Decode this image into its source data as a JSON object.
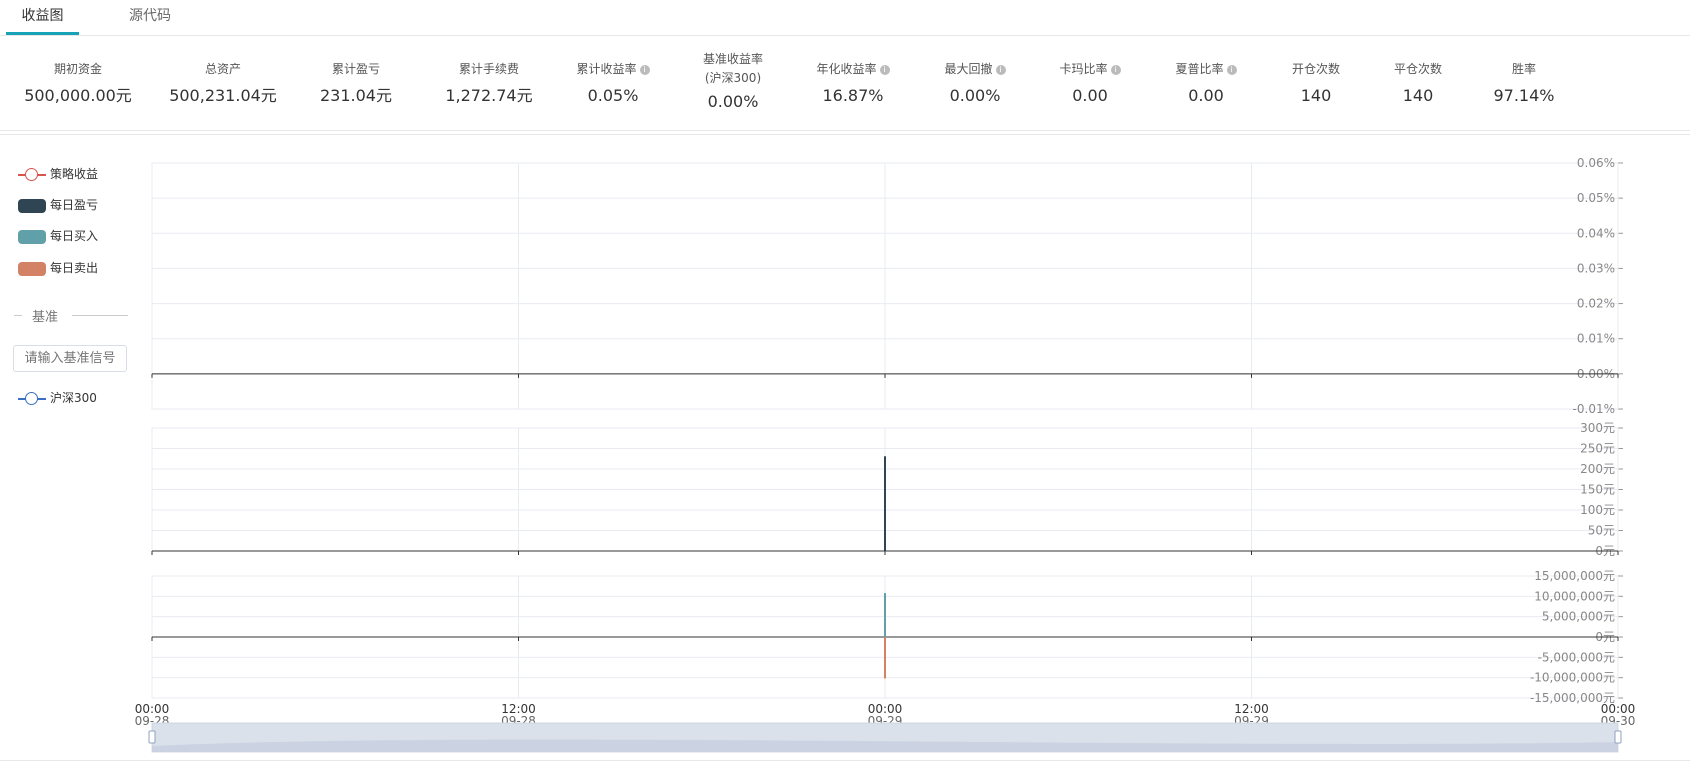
{
  "tabs": [
    {
      "label": "收益图"
    },
    {
      "label": "源代码"
    }
  ],
  "stats": [
    {
      "label": "期初资金",
      "value": "500,000.00元"
    },
    {
      "label": "总资产",
      "value": "500,231.04元"
    },
    {
      "label": "累计盈亏",
      "value": "231.04元"
    },
    {
      "label": "累计手续费",
      "value": "1,272.74元"
    },
    {
      "label": "累计收益率",
      "value": "0.05%"
    },
    {
      "label": "基准收益率",
      "label2": "(沪深300)",
      "value": "0.00%"
    },
    {
      "label": "年化收益率",
      "value": "16.87%"
    },
    {
      "label": "最大回撤",
      "value": "0.00%"
    },
    {
      "label": "卡玛比率",
      "value": "0.00"
    },
    {
      "label": "夏普比率",
      "value": "0.00"
    },
    {
      "label": "开仓次数",
      "value": "140"
    },
    {
      "label": "平仓次数",
      "value": "140"
    },
    {
      "label": "胜率",
      "value": "97.14%"
    }
  ],
  "info_icon": "i",
  "legend": [
    {
      "label": "策略收益",
      "type": "line",
      "color": "#d9534f"
    },
    {
      "label": "每日盈亏",
      "type": "rect",
      "color": "#2f4554"
    },
    {
      "label": "每日买入",
      "type": "rect",
      "color": "#61a0a8"
    },
    {
      "label": "每日卖出",
      "type": "rect",
      "color": "#d48265"
    }
  ],
  "benchmark": {
    "title": "基准",
    "placeholder": "请输入基准信号",
    "series": {
      "label": "沪深300",
      "color": "#3a6fc4"
    }
  },
  "chart_data": [
    {
      "type": "line",
      "y_tick_labels": [
        "0.06%",
        "0.05%",
        "0.04%",
        "0.03%",
        "0.02%",
        "0.01%",
        "0.00%",
        "-0.01%"
      ],
      "ylim": [
        -0.01,
        0.06
      ],
      "series": [
        {
          "name": "策略收益",
          "x": [],
          "values": []
        },
        {
          "name": "沪深300",
          "x": [],
          "values": []
        }
      ]
    },
    {
      "type": "bar",
      "y_tick_labels": [
        "300元",
        "250元",
        "200元",
        "150元",
        "100元",
        "50元",
        "0元"
      ],
      "ylim": [
        0,
        300
      ],
      "series": [
        {
          "name": "每日盈亏",
          "x": [
            "2023-09-29 00:00"
          ],
          "values": [
            231.04
          ]
        }
      ]
    },
    {
      "type": "bar",
      "y_tick_labels": [
        "15,000,000元",
        "10,000,000元",
        "5,000,000元",
        "0元",
        "-5,000,000元",
        "-10,000,000元",
        "-15,000,000元"
      ],
      "ylim": [
        -15000000,
        15000000
      ],
      "series": [
        {
          "name": "每日买入",
          "x": [
            "2023-09-29 00:00"
          ],
          "values": [
            10800000
          ]
        },
        {
          "name": "每日卖出",
          "x": [
            "2023-09-29 00:00"
          ],
          "values": [
            -10200000
          ]
        }
      ]
    }
  ],
  "x_axis": {
    "ticks": [
      {
        "time": "00:00",
        "date": "09-28"
      },
      {
        "time": "12:00",
        "date": "09-28"
      },
      {
        "time": "00:00",
        "date": "09-29"
      },
      {
        "time": "12:00",
        "date": "09-29"
      },
      {
        "time": "00:00",
        "date": "09-30"
      }
    ]
  },
  "datazoom": {
    "start": 0,
    "end": 100
  }
}
